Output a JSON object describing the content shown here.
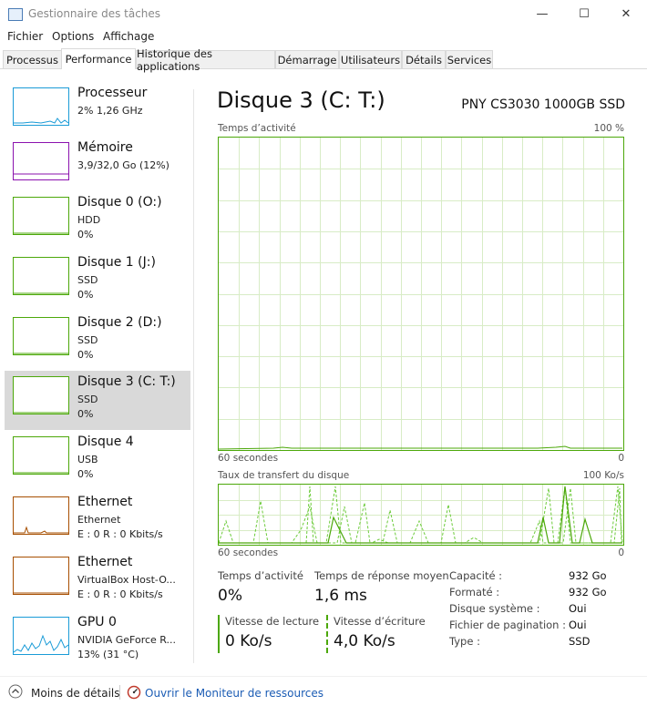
{
  "window": {
    "title": "Gestionnaire des tâches",
    "minimize_glyph": "—",
    "maximize_glyph": "☐",
    "close_glyph": "✕"
  },
  "menu": [
    "Fichier",
    "Options",
    "Affichage"
  ],
  "tabs": [
    {
      "label": "Processus",
      "active": false
    },
    {
      "label": "Performance",
      "active": true
    },
    {
      "label": "Historique des applications",
      "active": false
    },
    {
      "label": "Démarrage",
      "active": false
    },
    {
      "label": "Utilisateurs",
      "active": false
    },
    {
      "label": "Détails",
      "active": false
    },
    {
      "label": "Services",
      "active": false
    }
  ],
  "sidebar": {
    "items": [
      {
        "title": "Processeur",
        "sub1": "2%  1,26 GHz",
        "sub2": "",
        "color": "#1a9bd7"
      },
      {
        "title": "Mémoire",
        "sub1": "3,9/32,0 Go (12%)",
        "sub2": "",
        "color": "#8b12ae"
      },
      {
        "title": "Disque 0 (O:)",
        "sub1": "HDD",
        "sub2": "0%",
        "color": "#4ca80a"
      },
      {
        "title": "Disque 1 (J:)",
        "sub1": "SSD",
        "sub2": "0%",
        "color": "#4ca80a"
      },
      {
        "title": "Disque 2 (D:)",
        "sub1": "SSD",
        "sub2": "0%",
        "color": "#4ca80a"
      },
      {
        "title": "Disque 3 (C: T:)",
        "sub1": "SSD",
        "sub2": "0%",
        "color": "#4ca80a",
        "selected": true
      },
      {
        "title": "Disque 4",
        "sub1": "USB",
        "sub2": "0%",
        "color": "#4ca80a"
      },
      {
        "title": "Ethernet",
        "sub1": "Ethernet",
        "sub2": "E : 0  R : 0 Kbits/s",
        "color": "#a74f01"
      },
      {
        "title": "Ethernet",
        "sub1": "VirtualBox Host-O...",
        "sub2": "E : 0  R : 0 Kbits/s",
        "color": "#a74f01"
      },
      {
        "title": "GPU 0",
        "sub1": "NVIDIA GeForce R...",
        "sub2": "13%  (31 °C)",
        "color": "#1a9bd7"
      }
    ]
  },
  "main": {
    "title": "Disque 3 (C: T:)",
    "model": "PNY CS3030 1000GB SSD",
    "activity_label": "Temps d’activité",
    "activity_max": "100 %",
    "activity_time": "60 secondes",
    "activity_min": "0",
    "transfer_label": "Taux de transfert du disque",
    "transfer_max": "100 Ko/s",
    "transfer_time": "60 secondes",
    "transfer_min": "0",
    "stats": {
      "activity_label": "Temps d’activité",
      "activity_value": "0%",
      "response_label": "Temps de réponse moyen",
      "response_value": "1,6 ms",
      "read_label": "Vitesse de lecture",
      "read_value": "0 Ko/s",
      "write_label": "Vitesse d’écriture",
      "write_value": "4,0 Ko/s"
    },
    "specs": [
      {
        "label": "Capacité :",
        "value": "932 Go"
      },
      {
        "label": "Formaté :",
        "value": "932 Go"
      },
      {
        "label": "Disque système :",
        "value": "Oui"
      },
      {
        "label": "Fichier de pagination :",
        "value": "Oui"
      },
      {
        "label": "Type :",
        "value": "SSD"
      }
    ]
  },
  "footer": {
    "less_details": "Moins de détails",
    "resource_monitor": "Ouvrir le Moniteur de ressources"
  },
  "colors": {
    "disk": "#4ca80a",
    "grid": "#d8ecc6",
    "link": "#1b5cb4"
  }
}
